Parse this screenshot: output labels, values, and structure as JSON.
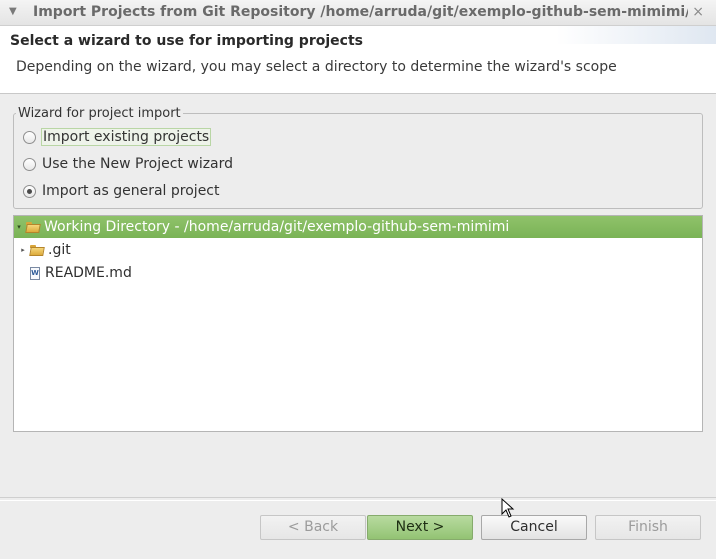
{
  "window": {
    "title": "Import Projects from Git Repository /home/arruda/git/exemplo-github-sem-mimimi/.g",
    "close_glyph": "×",
    "menu_glyph": "▼"
  },
  "header": {
    "title": "Select a wizard to use for importing projects",
    "description": "Depending on the wizard, you may select a directory to determine the wizard's scope"
  },
  "wizard_group": {
    "legend": "Wizard for project import",
    "options": [
      {
        "label": "Import existing projects",
        "checked": false
      },
      {
        "label": "Use the New Project wizard",
        "checked": false
      },
      {
        "label": "Import as general project",
        "checked": true
      }
    ]
  },
  "tree": {
    "items": [
      {
        "label": "Working Directory - /home/arruda/git/exemplo-github-sem-mimimi",
        "expander": "▾",
        "icon": "folder-open-icon",
        "selected": true
      },
      {
        "label": ".git",
        "expander": "▸",
        "icon": "folder-icon",
        "selected": false
      },
      {
        "label": "README.md",
        "expander": "",
        "icon": "file-icon",
        "file_badge": "W",
        "selected": false
      }
    ]
  },
  "buttons": {
    "back": "< Back",
    "next": "Next >",
    "cancel": "Cancel",
    "finish": "Finish"
  },
  "colors": {
    "selection": "#85ba60",
    "primary_button": "#a6cf8a"
  }
}
